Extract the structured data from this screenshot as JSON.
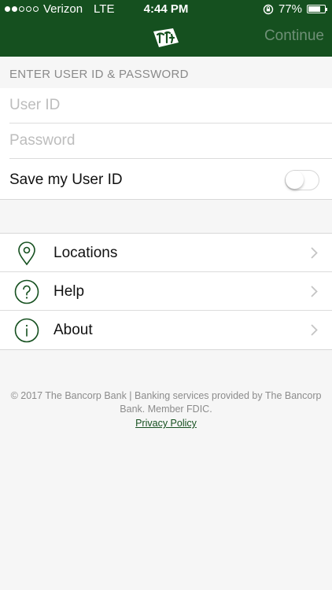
{
  "status_bar": {
    "carrier": "Verizon",
    "network": "LTE",
    "time": "4:44 PM",
    "battery_text": "77%",
    "battery_level": 0.77,
    "signal_bars_filled": 2,
    "signal_bars_total": 5
  },
  "nav": {
    "logo_icon": "cfd-logo",
    "continue_label": "Continue"
  },
  "login": {
    "section_title": "ENTER USER ID & PASSWORD",
    "user_id_placeholder": "User ID",
    "password_placeholder": "Password",
    "save_label": "Save my User ID",
    "save_toggle_on": false
  },
  "menu": {
    "items": [
      {
        "label": "Locations",
        "icon": "location-pin-icon"
      },
      {
        "label": "Help",
        "icon": "question-icon"
      },
      {
        "label": "About",
        "icon": "info-icon"
      }
    ]
  },
  "footer": {
    "copyright": "© 2017 The Bancorp Bank | Banking services provided by The Bancorp Bank. Member FDIC.",
    "privacy_link": "Privacy Policy"
  },
  "colors": {
    "brand_green": "#15501f",
    "continue_disabled": "#6f9077",
    "background": "#f6f6f6"
  }
}
